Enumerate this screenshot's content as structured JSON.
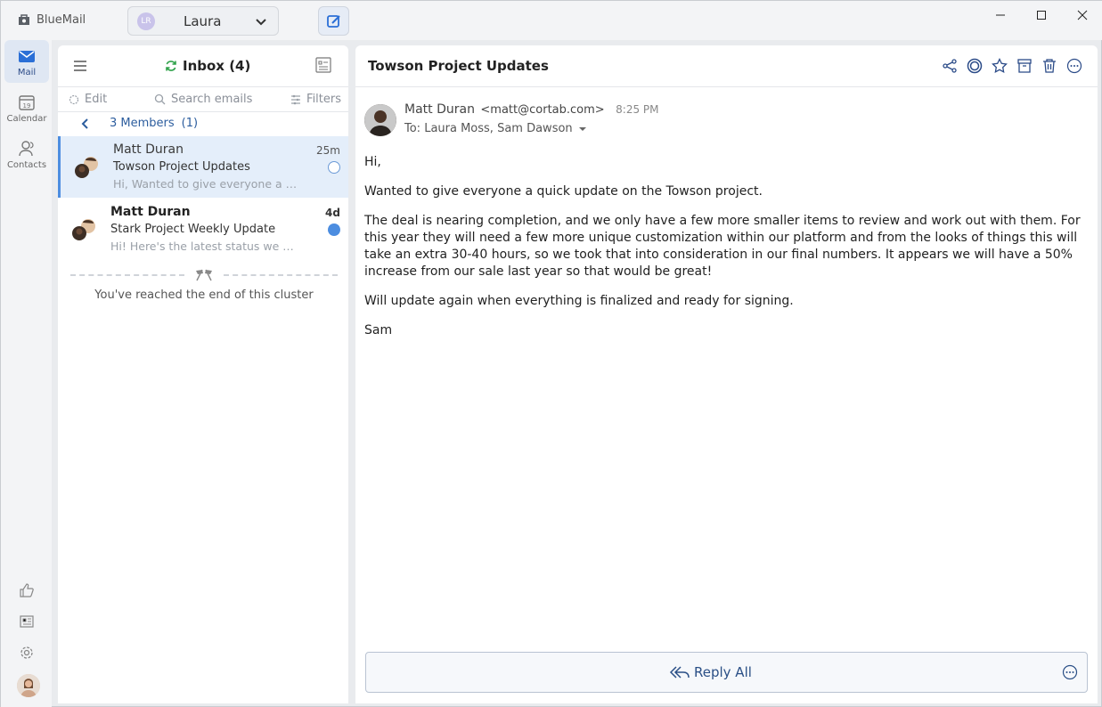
{
  "app": {
    "name": "BlueMail"
  },
  "account": {
    "initials": "LR",
    "name": "Laura"
  },
  "rail": {
    "items": [
      {
        "label": "Mail"
      },
      {
        "label": "Calendar",
        "day": "19"
      },
      {
        "label": "Contacts"
      }
    ]
  },
  "list": {
    "title": "Inbox (4)",
    "edit_label": "Edit",
    "search_placeholder": "Search emails",
    "filters_label": "Filters",
    "cluster_label": "3 Members",
    "cluster_count": "(1)",
    "end_text": "You've reached the end of this cluster",
    "messages": [
      {
        "from": "Matt Duran",
        "subject": "Towson Project Updates",
        "preview": "Hi, Wanted to give everyone a quick update on the Towson project.",
        "time": "25m"
      },
      {
        "from": "Matt Duran",
        "subject": "Stark Project Weekly Update",
        "preview": "Hi! Here's the latest status we have on the Stark project.",
        "time": "4d"
      }
    ]
  },
  "reader": {
    "subject": "Towson Project Updates",
    "sender_name": "Matt Duran",
    "sender_email": "<matt@cortab.com>",
    "time": "8:25 PM",
    "to": "To: Laura Moss, Sam Dawson",
    "body": [
      "Hi,",
      "Wanted to give everyone a quick update on the Towson project.",
      "The deal is nearing completion, and we only have a few more smaller items to review and work out with them. For this year they will need a few more unique customization within our platform and from the looks of things this will take an extra 30-40 hours, so we took that into consideration in our final numbers. It appears we will have a 50% increase from our sale last year so that would be great!",
      "Will update again when everything is finalized and ready for signing.",
      "Sam"
    ],
    "reply_label": "Reply All"
  },
  "colors": {
    "accent": "#2b6fd6",
    "selected_bg": "#e4eefa",
    "unread_dot": "#4c8de0"
  }
}
